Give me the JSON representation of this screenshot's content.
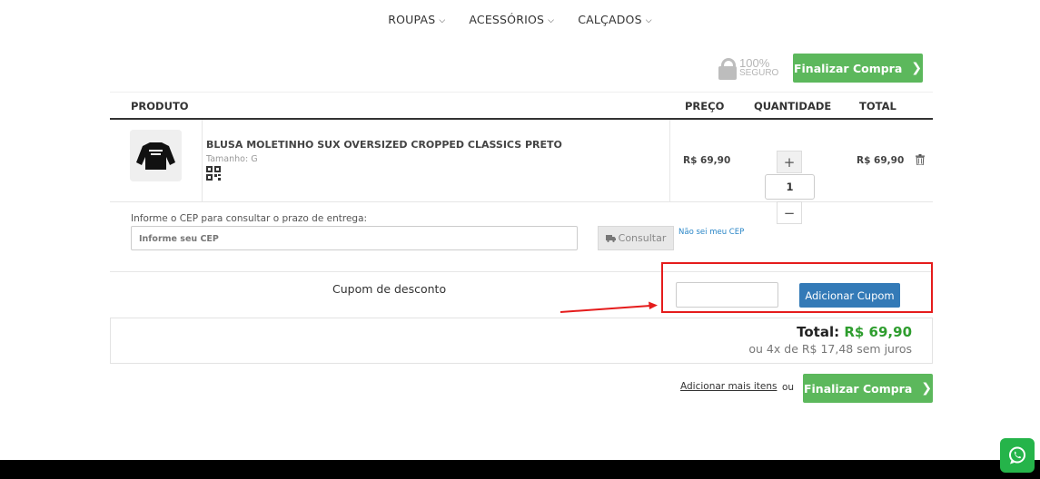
{
  "nav": {
    "items": [
      {
        "label": "ROUPAS"
      },
      {
        "label": "ACESSÓRIOS"
      },
      {
        "label": "CALÇADOS"
      }
    ]
  },
  "secure": {
    "percent": "100%",
    "label": "SEGURO"
  },
  "checkout_top": {
    "label": "Finalizar Compra"
  },
  "table": {
    "headers": {
      "product": "PRODUTO",
      "price": "PREÇO",
      "quantity": "QUANTIDADE",
      "total": "TOTAL"
    },
    "rows": [
      {
        "name": "BLUSA MOLETINHO SUX OVERSIZED CROPPED CLASSICS PRETO",
        "size": "Tamanho: G",
        "price": "R$ 69,90",
        "quantity": "1",
        "total": "R$ 69,90"
      }
    ]
  },
  "shipping": {
    "label": "Informe o CEP para consultar o prazo de entrega:",
    "placeholder": "Informe seu CEP",
    "button": "Consultar",
    "link": "Não sei meu CEP"
  },
  "coupon": {
    "label": "Cupom de desconto",
    "button": "Adicionar Cupom"
  },
  "summary": {
    "total_label": "Total:",
    "total_value": "R$ 69,90",
    "installments": "ou 4x de R$ 17,48 sem juros"
  },
  "bottom": {
    "add_more": "Adicionar mais itens",
    "or": "ou",
    "checkout": "Finalizar Compra"
  },
  "colors": {
    "green": "#5cb85c",
    "blue": "#337ab7",
    "highlight": "#e51c1c",
    "whatsapp": "#25b44a"
  }
}
